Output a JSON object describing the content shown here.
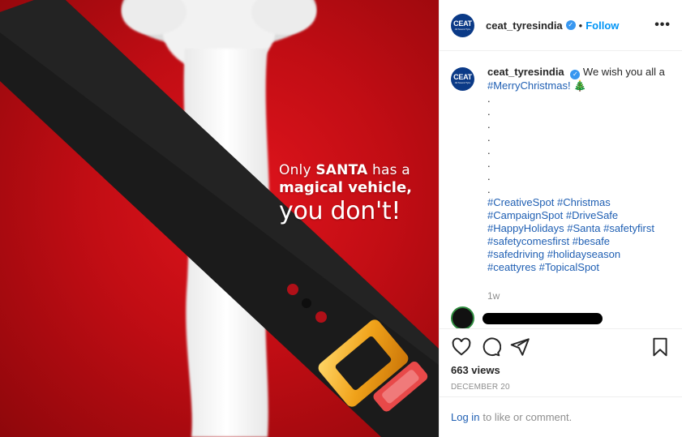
{
  "media": {
    "headline": {
      "line1_prefix": "Only ",
      "line1_bold": "SANTA",
      "line1_suffix": " has a",
      "line2": "magical vehicle,",
      "line3": "you don't!"
    }
  },
  "header": {
    "avatar_logo": "CEAT",
    "avatar_tag": "All Sound Tyre",
    "username": "ceat_tyresindia",
    "verified_icon": "verified-badge-icon",
    "separator": "•",
    "follow_label": "Follow",
    "more_icon": "•••"
  },
  "caption": {
    "username": "ceat_tyresindia",
    "text": "We wish you all a",
    "hashtag_line": "#MerryChristmas!",
    "tree_icon": "🎄",
    "dots": [
      ".",
      ".",
      ".",
      ".",
      ".",
      ".",
      ".",
      "."
    ],
    "hashtags": [
      "#CreativeSpot #Christmas",
      "#CampaignSpot #DriveSafe",
      "#HappyHolidays #Santa #safetyfirst",
      "#safetycomesfirst #besafe",
      "#safedriving #holidayseason",
      "#ceattyres #TopicalSpot"
    ],
    "time": "1w"
  },
  "stats": {
    "views": "663 views",
    "date": "DECEMBER 20"
  },
  "footer": {
    "login_label": "Log in",
    "login_suffix": "to like or comment."
  },
  "colors": {
    "link_blue": "#0095f6",
    "hashtag_blue": "#1f5fb3",
    "santa_red": "#d0121a",
    "belt_black": "#1a1a1a",
    "buckle_gold": "#f0a21a"
  }
}
